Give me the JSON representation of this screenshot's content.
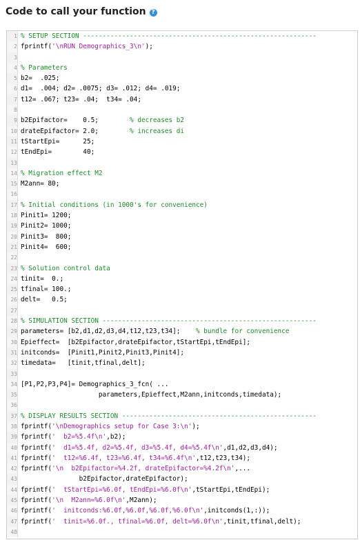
{
  "header": {
    "title": "Code to call your function",
    "help_icon": "?"
  },
  "colors": {
    "comment": "#1e8a2b",
    "string": "#a020a0",
    "text": "#000000",
    "help_icon": "#3d8fd1"
  },
  "code": {
    "lines": [
      [
        {
          "t": "cm",
          "s": "% SETUP SECTION ------------------------------------------------------------"
        }
      ],
      [
        {
          "t": "tx",
          "s": "fprintf("
        },
        {
          "t": "st",
          "s": "'\\nRUN Demographics_3\\n'"
        },
        {
          "t": "tx",
          "s": ");"
        }
      ],
      [],
      [
        {
          "t": "cm",
          "s": "% Parameters"
        }
      ],
      [
        {
          "t": "tx",
          "s": "b2=  .025;"
        }
      ],
      [
        {
          "t": "tx",
          "s": "d1=  .004; d2= .0075; d3= .012; d4= .019;"
        }
      ],
      [
        {
          "t": "tx",
          "s": "t12= .067; t23= .04;  t34= .04;"
        }
      ],
      [],
      [
        {
          "t": "tx",
          "s": "b2Epifactor=    0.5;        "
        },
        {
          "t": "cm",
          "s": "% decreases b2"
        }
      ],
      [
        {
          "t": "tx",
          "s": "drateEpifactor= 2.0;        "
        },
        {
          "t": "cm",
          "s": "% increases di"
        }
      ],
      [
        {
          "t": "tx",
          "s": "tStartEpi=      25;"
        }
      ],
      [
        {
          "t": "tx",
          "s": "tEndEpi=        40;"
        }
      ],
      [],
      [
        {
          "t": "cm",
          "s": "% Migration effect M2"
        }
      ],
      [
        {
          "t": "tx",
          "s": "M2ann= 80;"
        }
      ],
      [],
      [
        {
          "t": "cm",
          "s": "% Initial conditions (in 1000's for convenience)"
        }
      ],
      [
        {
          "t": "tx",
          "s": "Pinit1= 1200;"
        }
      ],
      [
        {
          "t": "tx",
          "s": "Pinit2= 1000;"
        }
      ],
      [
        {
          "t": "tx",
          "s": "Pinit3=  800;"
        }
      ],
      [
        {
          "t": "tx",
          "s": "Pinit4=  600;"
        }
      ],
      [],
      [
        {
          "t": "cm",
          "s": "% Solution control data"
        }
      ],
      [
        {
          "t": "tx",
          "s": "tinit=  0.;"
        }
      ],
      [
        {
          "t": "tx",
          "s": "tfinal= 100.;"
        }
      ],
      [
        {
          "t": "tx",
          "s": "delt=   0.5;"
        }
      ],
      [],
      [
        {
          "t": "cm",
          "s": "% SIMULATION SECTION -------------------------------------------------------"
        }
      ],
      [
        {
          "t": "tx",
          "s": "parameters= [b2,d1,d2,d3,d4,t12,t23,t34];    "
        },
        {
          "t": "cm",
          "s": "% bundle for convenience"
        }
      ],
      [
        {
          "t": "tx",
          "s": "Epieffect=  [b2Epifactor,drateEpifactor,tStartEpi,tEndEpi];"
        }
      ],
      [
        {
          "t": "tx",
          "s": "initconds=  [Pinit1,Pinit2,Pinit3,Pinit4];"
        }
      ],
      [
        {
          "t": "tx",
          "s": "timedata=   [tinit,tfinal,delt];"
        }
      ],
      [],
      [
        {
          "t": "tx",
          "s": "[P1,P2,P3,P4]= Demographics_3_fcn( ..."
        }
      ],
      [
        {
          "t": "tx",
          "s": "                    parameters,Epieffect,M2ann,initconds,timedata);"
        }
      ],
      [],
      [
        {
          "t": "cm",
          "s": "% DISPLAY RESULTS SECTION --------------------------------------------------"
        }
      ],
      [
        {
          "t": "tx",
          "s": "fprintf("
        },
        {
          "t": "st",
          "s": "'\\nDemographics setup for Case 3:\\n'"
        },
        {
          "t": "tx",
          "s": ");"
        }
      ],
      [
        {
          "t": "tx",
          "s": "fprintf("
        },
        {
          "t": "st",
          "s": "'  b2=%5.4f\\n'"
        },
        {
          "t": "tx",
          "s": ",b2);"
        }
      ],
      [
        {
          "t": "tx",
          "s": "fprintf("
        },
        {
          "t": "st",
          "s": "'  d1=%5.4f, d2=%5.4f, d3=%5.4f, d4=%5.4f\\n'"
        },
        {
          "t": "tx",
          "s": ",d1,d2,d3,d4);"
        }
      ],
      [
        {
          "t": "tx",
          "s": "fprintf("
        },
        {
          "t": "st",
          "s": "'  t12=%6.4f, t23=%6.4f, t34=%6.4f\\n'"
        },
        {
          "t": "tx",
          "s": ",t12,t23,t34);"
        }
      ],
      [
        {
          "t": "tx",
          "s": "fprintf("
        },
        {
          "t": "st",
          "s": "'\\n  b2Epifactor=%4.2f, drateEpifactor=%4.2f\\n'"
        },
        {
          "t": "tx",
          "s": ",..."
        }
      ],
      [
        {
          "t": "tx",
          "s": "               b2Epifactor,drateEpifactor);"
        }
      ],
      [
        {
          "t": "tx",
          "s": "fprintf("
        },
        {
          "t": "st",
          "s": "'  tStartEpi=%6.0f, tEndEpi=%6.0f\\n'"
        },
        {
          "t": "tx",
          "s": ",tStartEpi,tEndEpi);"
        }
      ],
      [
        {
          "t": "tx",
          "s": "fprintf("
        },
        {
          "t": "st",
          "s": "'\\n  M2ann=%6.0f\\n'"
        },
        {
          "t": "tx",
          "s": ",M2ann);"
        }
      ],
      [
        {
          "t": "tx",
          "s": "fprintf("
        },
        {
          "t": "st",
          "s": "'  initconds:%6.0f,%6.0f,%6.0f,%6.0f\\n'"
        },
        {
          "t": "tx",
          "s": ",initconds(1,:));"
        }
      ],
      [
        {
          "t": "tx",
          "s": "fprintf("
        },
        {
          "t": "st",
          "s": "'  tinit=%6.0f., tfinal=%6.0f, delt=%6.0f\\n'"
        },
        {
          "t": "tx",
          "s": ",tinit,tfinal,delt);"
        }
      ],
      []
    ]
  }
}
